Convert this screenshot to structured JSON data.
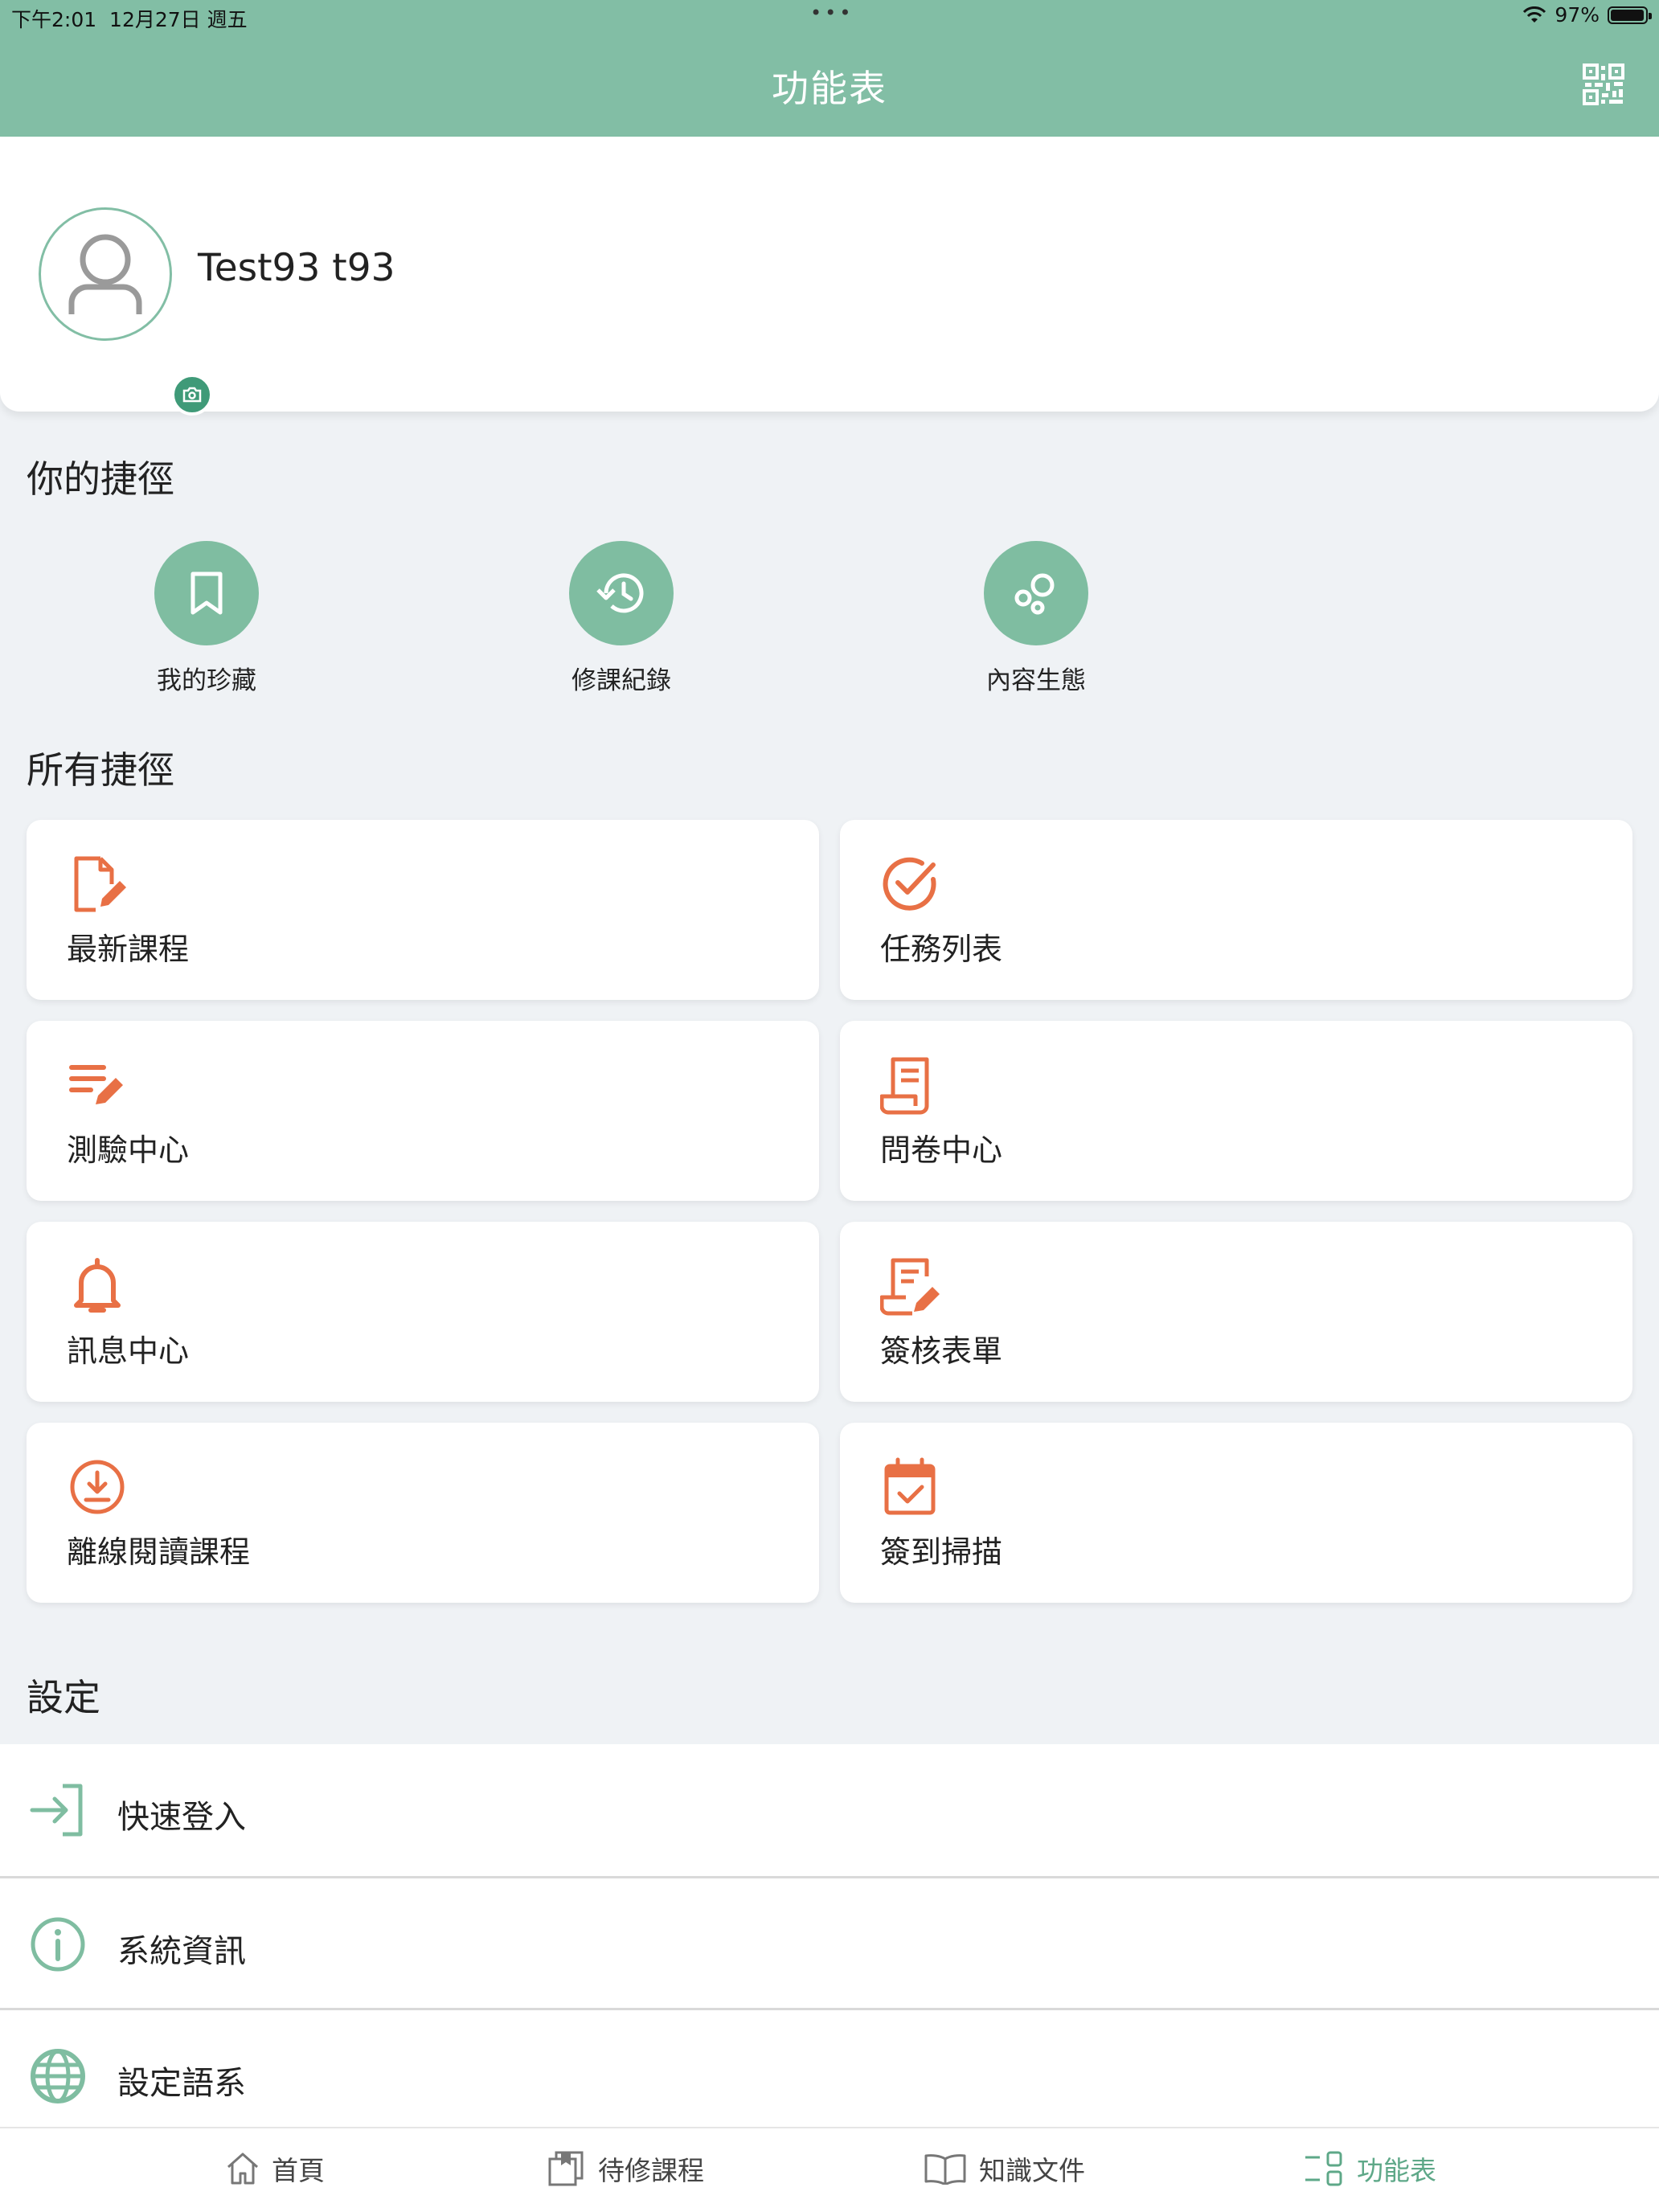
{
  "status_bar": {
    "time": "下午2:01",
    "date": "12月27日 週五",
    "dots": "•••",
    "battery": "97%",
    "battery_level": 0.97
  },
  "nav": {
    "title": "功能表",
    "qr_icon": "qr-code-icon"
  },
  "profile": {
    "name": "Test93 t93"
  },
  "favorites": {
    "title": "你的捷徑",
    "items": [
      {
        "label": "我的珍藏",
        "icon": "bookmark-icon"
      },
      {
        "label": "修課紀錄",
        "icon": "history-icon"
      },
      {
        "label": "內容生態",
        "icon": "bubbles-icon"
      }
    ]
  },
  "shortcuts": {
    "title": "所有捷徑",
    "items": [
      {
        "label": "最新課程",
        "icon": "document-edit-icon"
      },
      {
        "label": "任務列表",
        "icon": "check-circle-icon"
      },
      {
        "label": "測驗中心",
        "icon": "list-edit-icon"
      },
      {
        "label": "問卷中心",
        "icon": "receipt-icon"
      },
      {
        "label": "訊息中心",
        "icon": "bell-icon"
      },
      {
        "label": "簽核表單",
        "icon": "form-sign-icon"
      },
      {
        "label": "離線閱讀課程",
        "icon": "download-circle-icon"
      },
      {
        "label": "簽到掃描",
        "icon": "calendar-check-icon"
      }
    ]
  },
  "settings": {
    "title": "設定",
    "items": [
      {
        "label": "快速登入",
        "icon": "login-icon"
      },
      {
        "label": "系統資訊",
        "icon": "info-icon"
      },
      {
        "label": "設定語系",
        "icon": "globe-icon"
      }
    ]
  },
  "tabs": [
    {
      "label": "首頁",
      "icon": "home-icon"
    },
    {
      "label": "待修課程",
      "icon": "courses-icon"
    },
    {
      "label": "知識文件",
      "icon": "book-icon"
    },
    {
      "label": "功能表",
      "icon": "menu-grid-icon",
      "active": true
    }
  ],
  "colors": {
    "primary": "#82bea5",
    "accent_orange": "#e87045",
    "settings_icon": "#7fbda1",
    "active_tab": "#5ea888"
  }
}
